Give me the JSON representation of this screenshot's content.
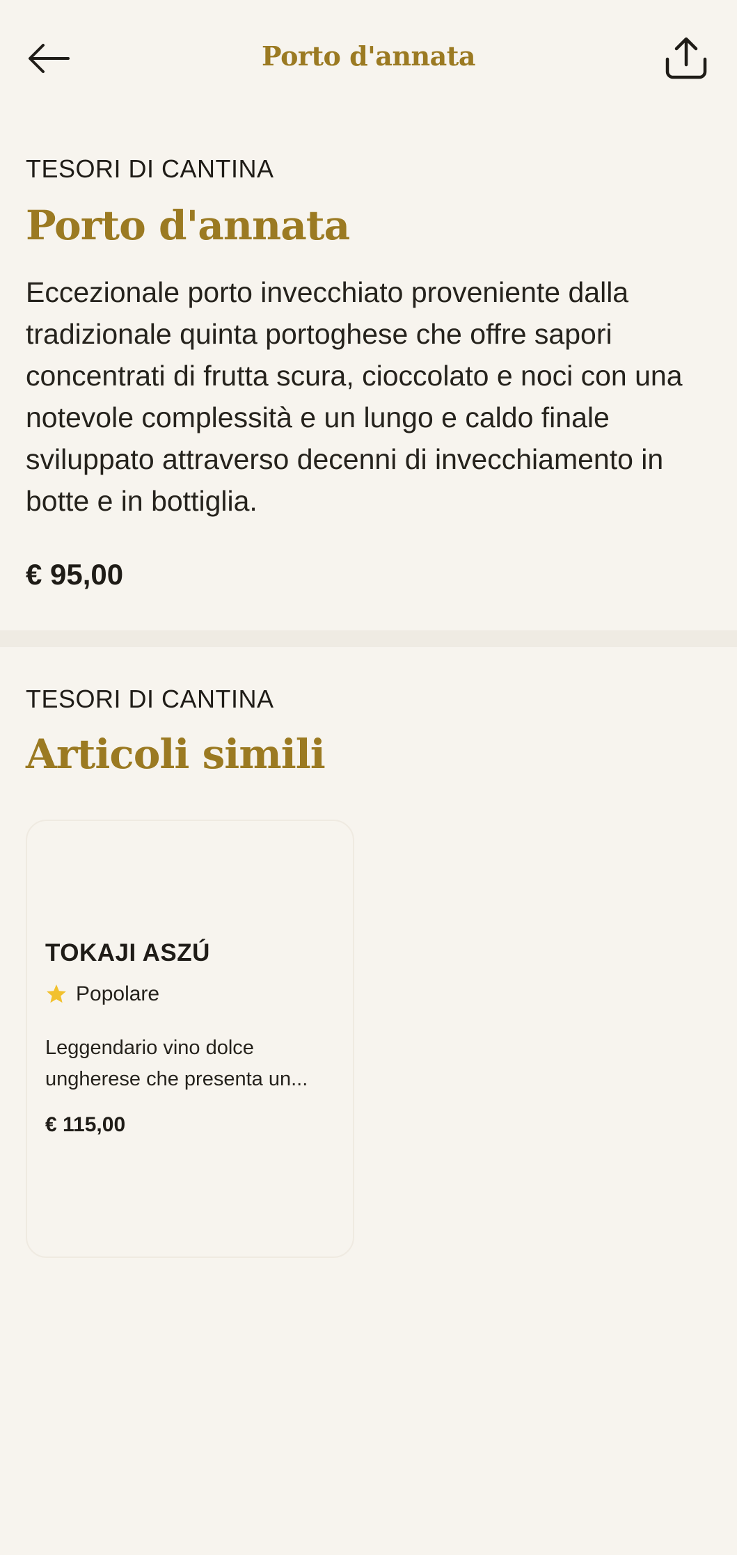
{
  "header": {
    "title": "Porto d'annata",
    "back_icon": "arrow-left-icon",
    "share_icon": "share-icon"
  },
  "product": {
    "category": "TESORI DI CANTINA",
    "name": "Porto d'annata",
    "description": "Eccezionale porto invecchiato proveniente dalla tradizionale quinta portoghese che offre sapori concentrati di frutta scura, cioccolato e noci con una notevole complessità e un lungo e caldo finale sviluppato attraverso decenni di invecchiamento in botte e in bottiglia.",
    "price": "€ 95,00"
  },
  "similar": {
    "category": "TESORI DI CANTINA",
    "title": "Articoli simili",
    "items": [
      {
        "name": "TOKAJI ASZÚ",
        "badge_icon": "star-icon",
        "badge": "Popolare",
        "description": "Leggendario vino dolce ungherese che presenta un...",
        "price": "€ 115,00"
      }
    ]
  },
  "colors": {
    "background": "#f7f4ee",
    "accent_gold": "#9b7a22",
    "star": "#f2c12e",
    "text": "#1f1c17"
  }
}
